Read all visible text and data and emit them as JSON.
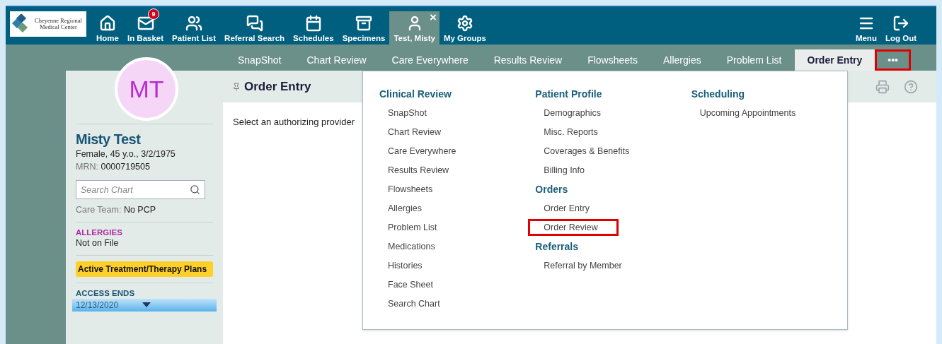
{
  "logo": {
    "line1": "Cheyenne Regional",
    "line2": "Medical Center"
  },
  "nav": [
    {
      "label": "Home",
      "selected": false
    },
    {
      "label": "In Basket",
      "selected": false,
      "badge": "9"
    },
    {
      "label": "Patient List",
      "selected": false
    },
    {
      "label": "Referral Search",
      "selected": false
    },
    {
      "label": "Schedules",
      "selected": false
    },
    {
      "label": "Specimens",
      "selected": false
    },
    {
      "label": "Test, Misty",
      "selected": true,
      "close": "×"
    },
    {
      "label": "My Groups",
      "selected": false
    }
  ],
  "right_nav": [
    {
      "label": "Menu"
    },
    {
      "label": "Log Out"
    }
  ],
  "tabs": [
    {
      "label": "SnapShot",
      "selected": false,
      "highlighted": false
    },
    {
      "label": "Chart Review",
      "selected": false,
      "highlighted": false
    },
    {
      "label": "Care Everywhere",
      "selected": false,
      "highlighted": false
    },
    {
      "label": "Results Review",
      "selected": false,
      "highlighted": false
    },
    {
      "label": "Flowsheets",
      "selected": false,
      "highlighted": false
    },
    {
      "label": "Allergies",
      "selected": false,
      "highlighted": false
    },
    {
      "label": "Problem List",
      "selected": false,
      "highlighted": false
    },
    {
      "label": "Order Entry",
      "selected": true,
      "highlighted": false
    },
    {
      "label": "•••",
      "selected": false,
      "highlighted": true
    }
  ],
  "patient": {
    "initials": "MT",
    "name": "Misty Test",
    "details": "Female, 45 y.o., 3/2/1975",
    "mrn_label": "MRN:",
    "mrn": "0000719505",
    "search_placeholder": "Search Chart",
    "care_team_label": "Care Team:",
    "care_team": "No PCP",
    "allergies_label": "ALLERGIES",
    "allergies": "Not on File",
    "plans_button": "Active Treatment/Therapy Plans",
    "access_label": "ACCESS ENDS",
    "access_date": "12/13/2020"
  },
  "activity": {
    "title": "Order Entry",
    "message": "Select an authorizing provider"
  },
  "menu": {
    "columns": [
      {
        "sections": [
          {
            "heading": "Clinical Review",
            "items": [
              {
                "label": "SnapShot",
                "highlighted": false
              },
              {
                "label": "Chart Review",
                "highlighted": false
              },
              {
                "label": "Care Everywhere",
                "highlighted": false
              },
              {
                "label": "Results Review",
                "highlighted": false
              },
              {
                "label": "Flowsheets",
                "highlighted": false
              },
              {
                "label": "Allergies",
                "highlighted": false
              },
              {
                "label": "Problem List",
                "highlighted": false
              },
              {
                "label": "Medications",
                "highlighted": false
              },
              {
                "label": "Histories",
                "highlighted": false
              },
              {
                "label": "Face Sheet",
                "highlighted": false
              },
              {
                "label": "Search Chart",
                "highlighted": false
              }
            ]
          }
        ]
      },
      {
        "sections": [
          {
            "heading": "Patient Profile",
            "items": [
              {
                "label": "Demographics",
                "highlighted": false
              },
              {
                "label": "Misc. Reports",
                "highlighted": false
              },
              {
                "label": "Coverages & Benefits",
                "highlighted": false
              },
              {
                "label": "Billing Info",
                "highlighted": false
              }
            ]
          },
          {
            "heading": "Orders",
            "items": [
              {
                "label": "Order Entry",
                "highlighted": false
              },
              {
                "label": "Order Review",
                "highlighted": true
              }
            ]
          },
          {
            "heading": "Referrals",
            "items": [
              {
                "label": "Referral by Member",
                "highlighted": false
              }
            ]
          }
        ]
      },
      {
        "sections": [
          {
            "heading": "Scheduling",
            "items": [
              {
                "label": "Upcoming Appointments",
                "highlighted": false
              }
            ]
          }
        ]
      }
    ]
  }
}
